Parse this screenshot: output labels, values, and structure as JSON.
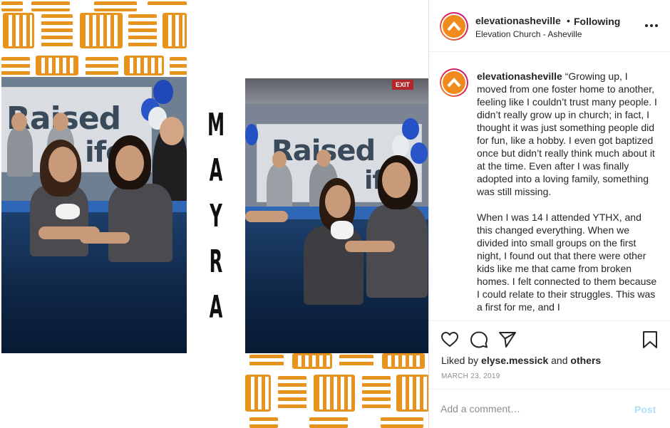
{
  "post_media": {
    "photo_1_banner_text": "Raised",
    "photo_1_banner_text_2": "ife",
    "photo_2_banner_text": "Raised",
    "photo_2_banner_text_2": "ife",
    "name_letters": [
      "M",
      "A",
      "Y",
      "R",
      "A"
    ],
    "exit_sign": "EXIT"
  },
  "header": {
    "username": "elevationasheville",
    "separator": "•",
    "follow_status": "Following",
    "location": "Elevation Church - Asheville",
    "more_icon": "more-horizontal-icon"
  },
  "caption": {
    "username": "elevationasheville",
    "paragraph_1": "“Growing up, I moved from one foster home to another, feeling like I couldn’t trust many people. I didn’t really grow up in church; in fact, I thought it was just something people did for fun, like a hobby. I even got baptized once but didn’t really think much about it at the time. Even after I was finally adopted into a loving family, something was still missing.",
    "paragraph_2": "When I was 14 I attended YTHX, and this changed everything. When we divided into small groups on the first night, I found out that there were other kids like me that came from broken homes. I felt connected to them because I could relate to their struggles. This was a first for me, and I"
  },
  "actions": {
    "like_icon": "heart-icon",
    "comment_icon": "comment-icon",
    "share_icon": "paper-plane-icon",
    "save_icon": "bookmark-icon",
    "liked_by_prefix": "Liked by",
    "liked_by_user": "elyse.messick",
    "liked_by_and": "and",
    "liked_by_others": "others",
    "date": "MARCH 23, 2019"
  },
  "comment": {
    "placeholder": "Add a comment…",
    "post_label": "Post"
  },
  "colors": {
    "accent_orange": "#f08a1c",
    "pattern_orange": "#e8931e",
    "post_disabled": "#b2dffc",
    "text_primary": "#262626",
    "text_secondary": "#8e8e8e"
  }
}
